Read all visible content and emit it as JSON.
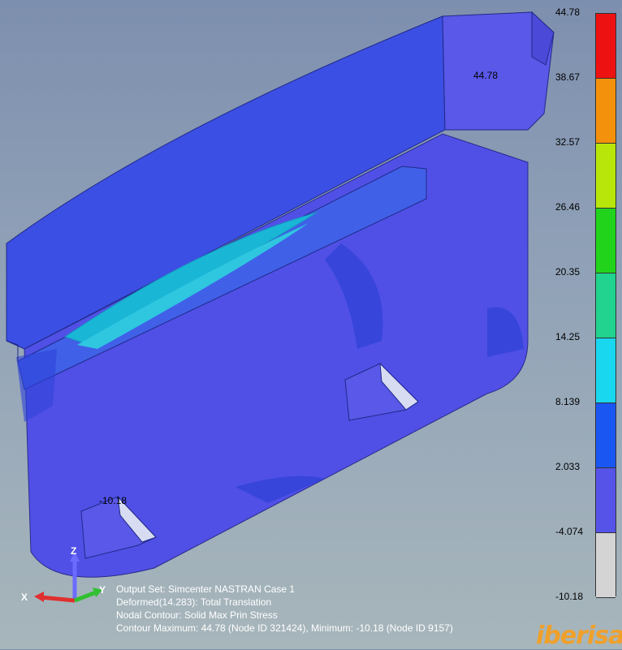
{
  "legend": {
    "labels": [
      "44.78",
      "38.67",
      "32.57",
      "26.46",
      "20.35",
      "14.25",
      "8.139",
      "2.033",
      "-4.074",
      "-10.18"
    ],
    "colors": [
      "#ee1111",
      "#f4910c",
      "#b8e60a",
      "#22d31c",
      "#21d38e",
      "#18d7ee",
      "#1a56f2",
      "#5553e8",
      "#d4d4d4"
    ]
  },
  "model": {
    "max_label": "44.78",
    "min_label": "-10.18"
  },
  "info": {
    "line1": "Output Set: Simcenter NASTRAN Case 1",
    "line2": "Deformed(14.283): Total Translation",
    "line3": "Nodal Contour: Solid Max Prin Stress",
    "line4": "Contour Maximum: 44.78 (Node ID 321424), Minimum: -10.18 (Node ID 9157)"
  },
  "axes": {
    "x": "X",
    "y": "Y",
    "z": "Z"
  },
  "logo": "iberisa"
}
